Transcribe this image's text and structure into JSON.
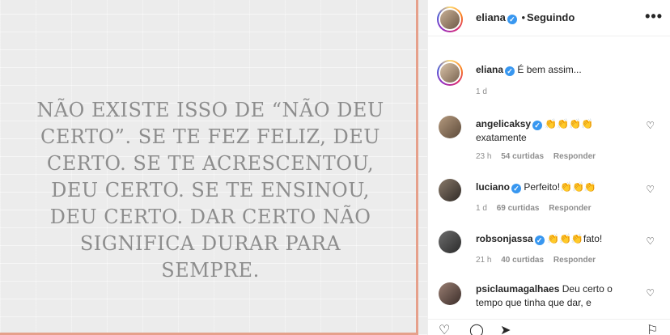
{
  "post": {
    "quote": "NÃO EXISTE ISSO DE “NÃO DEU CERTO”. SE TE FEZ FELIZ, DEU CERTO. SE TE ACRESCENTOU, DEU CERTO. SE TE ENSINOU, DEU CERTO. DAR CERTO NÃO SIGNIFICA DURAR PARA SEMPRE."
  },
  "header": {
    "username": "eliana",
    "separator": "•",
    "follow_status": "Seguindo",
    "more_icon": "more-horizontal-icon"
  },
  "caption": {
    "username": "eliana",
    "text": "É bem assim...",
    "time": "1 d"
  },
  "comments": [
    {
      "username": "angelicaksy",
      "text": "👏👏👏👏",
      "text2": "exatamente",
      "time": "23 h",
      "likes": "54 curtidas",
      "reply": "Responder"
    },
    {
      "username": "luciano",
      "text": "Perfeito!👏👏👏",
      "text2": "",
      "time": "1 d",
      "likes": "69 curtidas",
      "reply": "Responder"
    },
    {
      "username": "robsonjassa",
      "text": "👏👏👏fato!",
      "text2": "",
      "time": "21 h",
      "likes": "40 curtidas",
      "reply": "Responder"
    },
    {
      "username": "psiclaumagalhaes",
      "text": "Deu certo o tempo que tinha que dar, e",
      "text2": "",
      "time": "",
      "likes": "",
      "reply": ""
    }
  ],
  "icons": {
    "verified": "✓",
    "heart": "♡",
    "comment": "◯",
    "share": "➤",
    "save": "⚐"
  },
  "colors": {
    "verified": "#3897f0",
    "frame_accent": "#e6a08b"
  }
}
